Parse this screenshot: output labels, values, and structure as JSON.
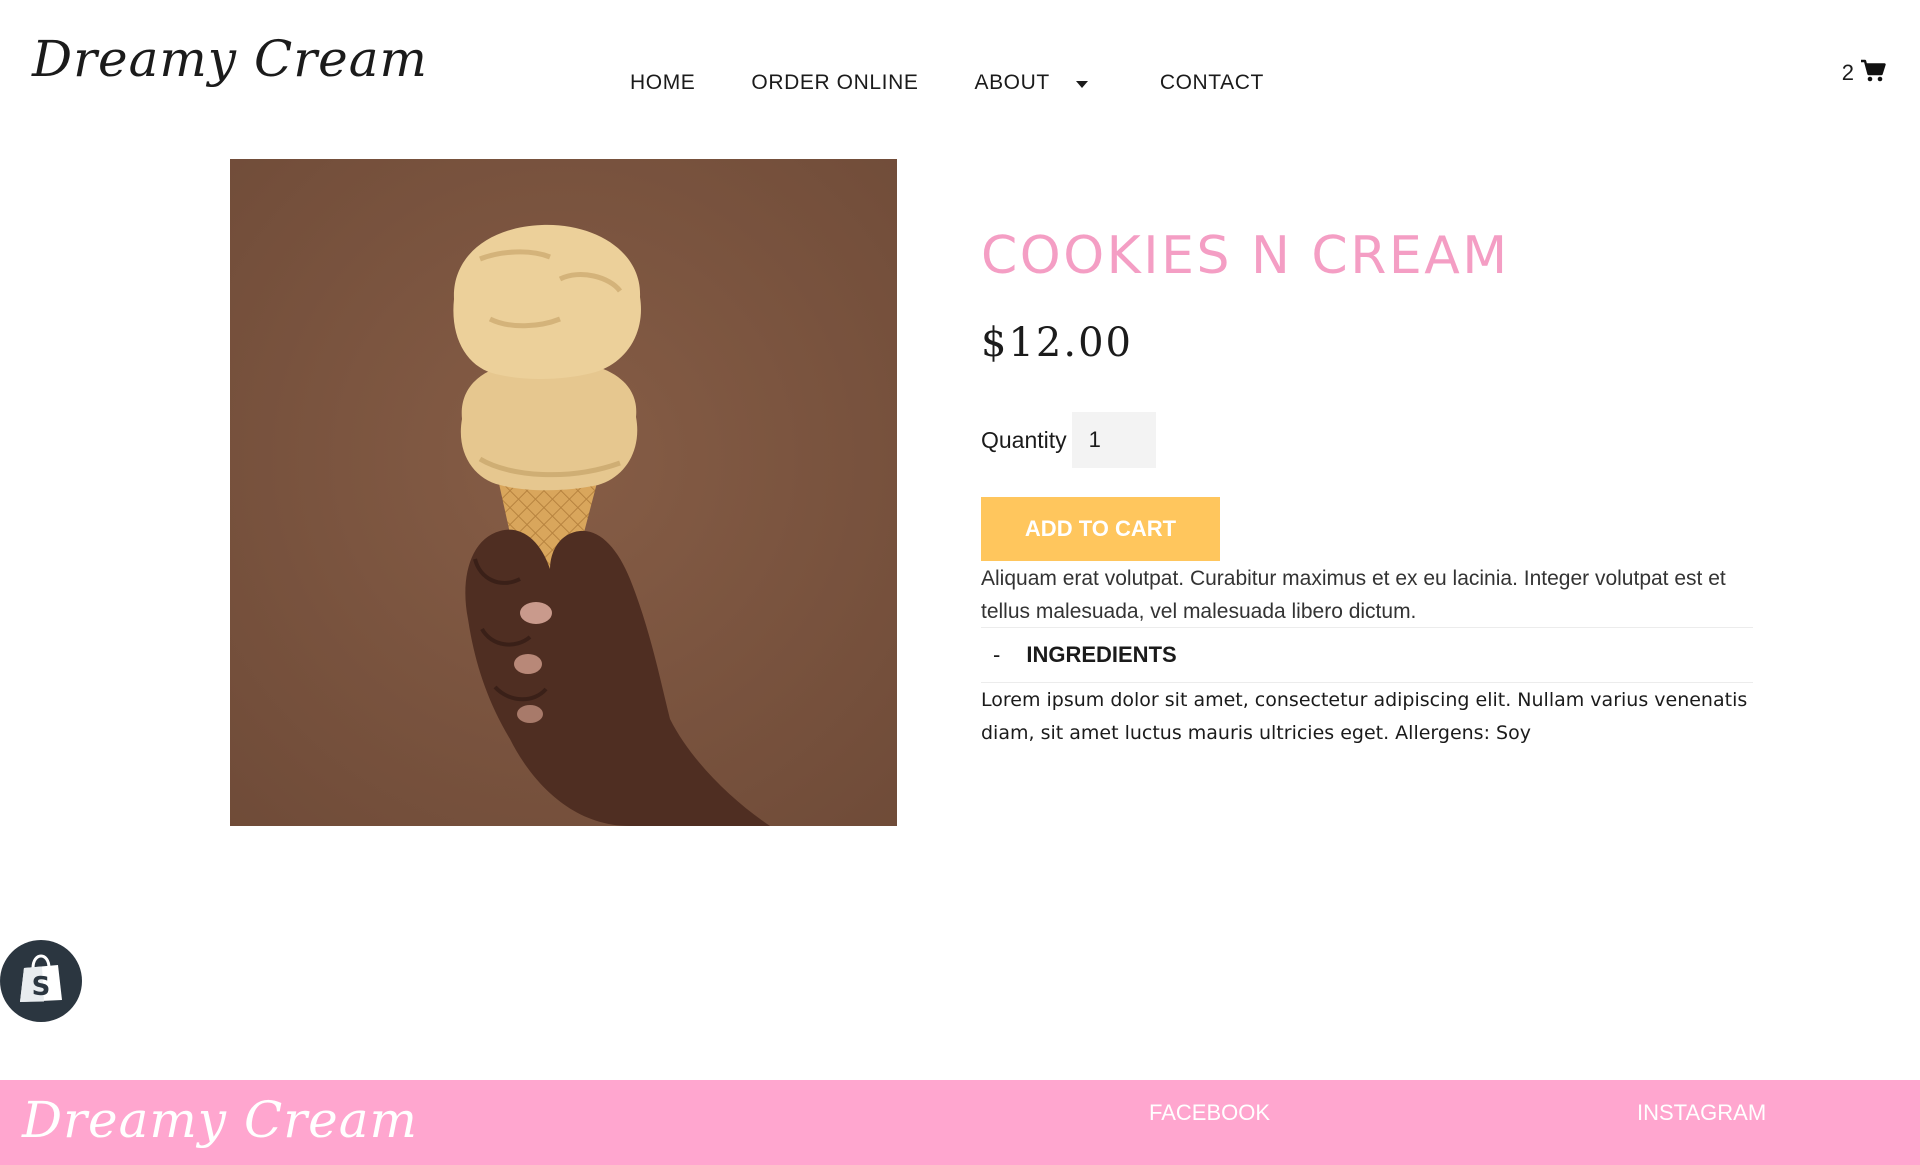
{
  "header": {
    "logo_text": "Dreamy Cream",
    "nav": {
      "home": "HOME",
      "order_online": "ORDER ONLINE",
      "about": "ABOUT",
      "contact": "CONTACT"
    },
    "cart_count": "2",
    "cart_icon": "shopping-cart-icon"
  },
  "product": {
    "title": "COOKIES N CREAM",
    "price": "$12.00",
    "quantity_label": "Quantity",
    "quantity_value": "1",
    "add_to_cart_label": "ADD TO CART",
    "description": "Aliquam erat volutpat. Curabitur maximus et ex eu lacinia. Integer volutpat est et tellus malesuada, vel malesuada libero dictum.",
    "ingredients": {
      "toggle": "-",
      "label": "INGREDIENTS",
      "body": "Lorem ipsum dolor sit amet, consectetur adipiscing elit. Nullam varius venenatis diam, sit amet luctus mauris ultricies eget. Allergens: Soy"
    }
  },
  "shop_badge": {
    "icon": "shopify-bag-icon"
  },
  "footer": {
    "logo_text": "Dreamy Cream",
    "facebook": "FACEBOOK",
    "instagram": "INSTAGRAM"
  },
  "colors": {
    "title_pink": "#f49ec4",
    "button_yellow": "#ffc65d",
    "footer_pink": "#ffa6cf",
    "image_background": "#7c5641",
    "badge_dark": "#2b3640"
  }
}
